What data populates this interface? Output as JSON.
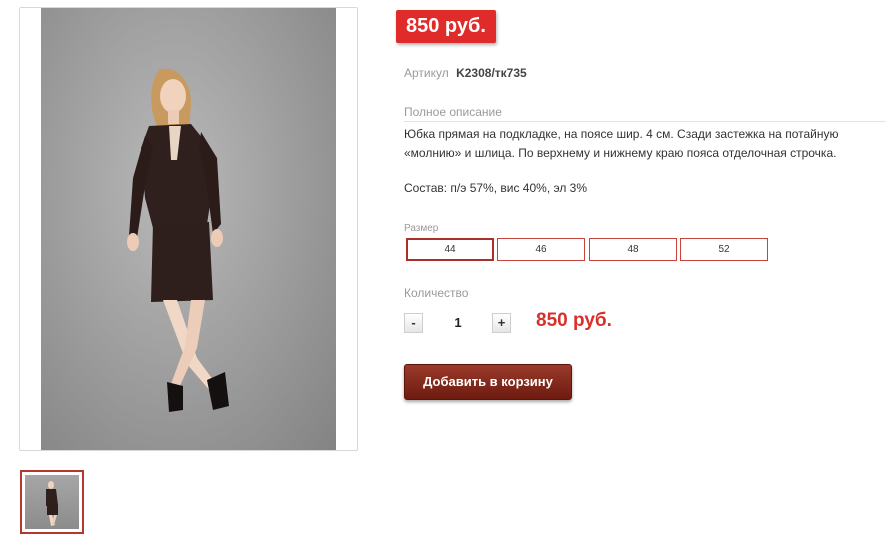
{
  "product": {
    "price_badge": "850 руб.",
    "sku_label": "Артикул",
    "sku_value": "K2308/тк735",
    "description_label": "Полное описание",
    "description_text": "Юбка прямая на подкладке, на поясе шир. 4 см. Сзади застежка на потайную «молнию» и шлица. По верхнему и нижнему краю пояса отделочная строчка.",
    "composition": "Состав: п/э 57%, вис 40%, эл 3%"
  },
  "sizes": {
    "label": "Размер",
    "options": [
      "44",
      "46",
      "48",
      "52"
    ],
    "selected": "44"
  },
  "quantity": {
    "label": "Количество",
    "minus": "-",
    "value": "1",
    "plus": "+",
    "total_price": "850 руб."
  },
  "cart": {
    "add_label": "Добавить в корзину"
  },
  "colors": {
    "accent_red": "#e02b2b",
    "button_brown": "#7a2416",
    "size_border": "#c8433b"
  }
}
